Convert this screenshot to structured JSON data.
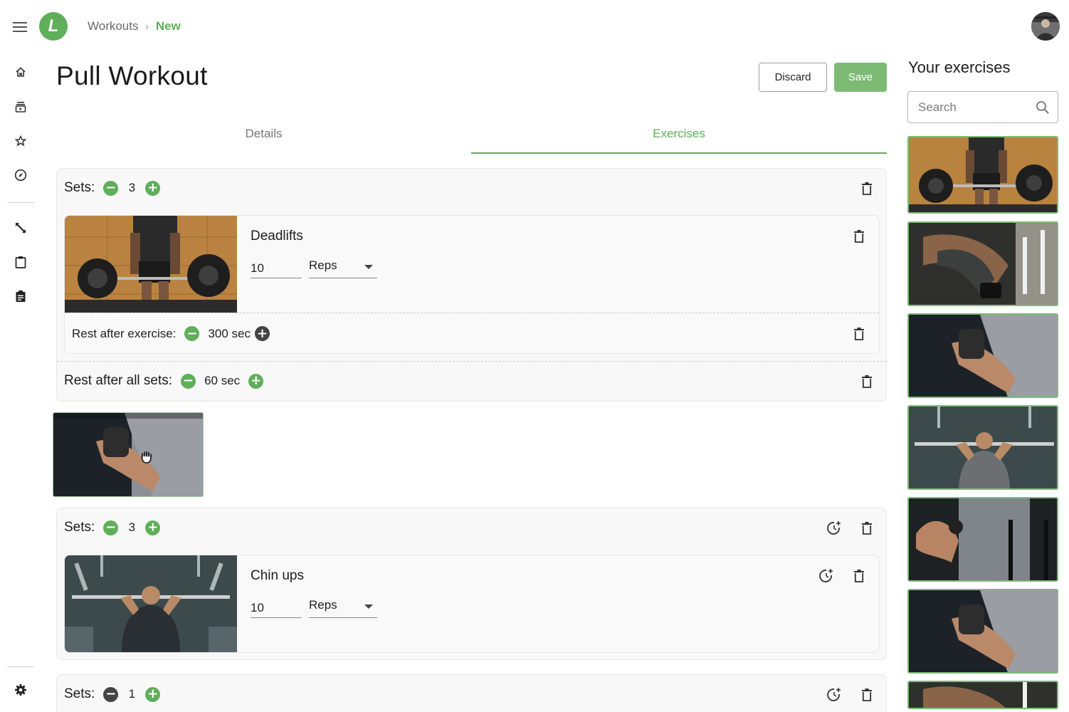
{
  "app": {
    "logo_letter": "L"
  },
  "breadcrumb": {
    "parent": "Workouts",
    "separator": "›",
    "current": "New"
  },
  "page": {
    "title": "Pull Workout"
  },
  "actions": {
    "discard": "Discard",
    "save": "Save"
  },
  "tabs": [
    {
      "label": "Details",
      "active": false
    },
    {
      "label": "Exercises",
      "active": true
    }
  ],
  "sidebar": {
    "icons": [
      "home-icon",
      "subscriptions-icon",
      "star-icon",
      "explore-icon",
      "swap-icon",
      "clipboard-icon",
      "assignment-icon",
      "settings-icon"
    ]
  },
  "groups": [
    {
      "sets_label": "Sets:",
      "sets": "3",
      "exercise": {
        "name": "Deadlifts",
        "reps": "10",
        "unit": "Reps"
      },
      "rest_after_exercise": {
        "label": "Rest after exercise:",
        "value": "300 sec"
      },
      "rest_after_sets": {
        "label": "Rest after all sets:",
        "value": "60 sec"
      }
    },
    {
      "sets_label": "Sets:",
      "sets": "3",
      "exercise": {
        "name": "Chin ups",
        "reps": "10",
        "unit": "Reps"
      }
    },
    {
      "sets_label": "Sets:",
      "sets": "1"
    }
  ],
  "right_panel": {
    "title": "Your exercises",
    "search_placeholder": "Search",
    "thumbnails": [
      "deadlift",
      "dumbbell-row",
      "bicep-curl",
      "chin-up",
      "cable-curl",
      "bicep-curl",
      "dumbbell-row"
    ]
  },
  "colors": {
    "accent": "#5fae5a",
    "save_button": "#7dbb74",
    "thumb_border": "#7dbb74"
  }
}
